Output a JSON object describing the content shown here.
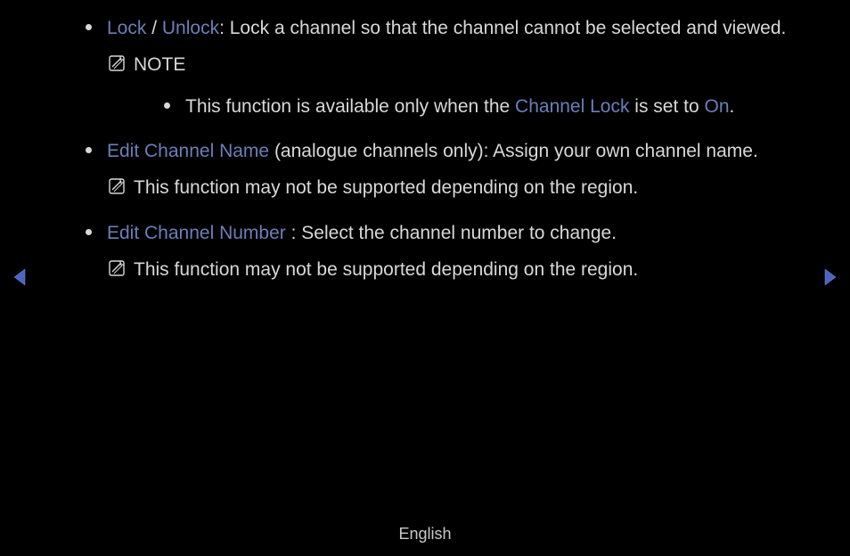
{
  "items": [
    {
      "title_a": "Lock",
      "sep": " / ",
      "title_b": "Unlock",
      "desc": ": Lock a channel so that the channel cannot be selected and viewed.",
      "note_label": "NOTE",
      "sub": {
        "pre": "This function is available only when the ",
        "hl1": "Channel Lock",
        "mid": " is set to ",
        "hl2": "On",
        "post": "."
      }
    },
    {
      "title": "Edit Channel Name",
      "paren": " (analogue channels only): ",
      "desc": "Assign your own channel name.",
      "note": "This function may not be supported depending on the region."
    },
    {
      "title": "Edit Channel Number",
      "desc": " : Select the channel number to change.",
      "note": "This function may not be supported depending on the region."
    }
  ],
  "footer": "English"
}
